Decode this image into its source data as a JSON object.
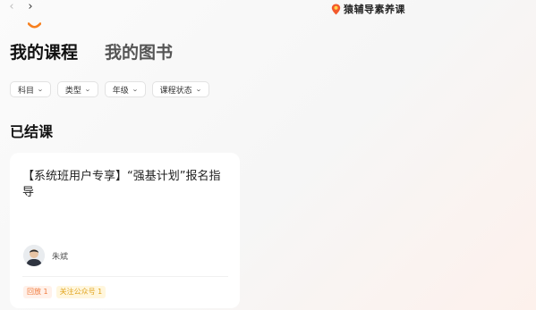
{
  "window": {
    "nav_back_icon": "chevron-left-icon",
    "nav_forward_icon": "chevron-right-icon",
    "brand_name": "猿辅导素养课",
    "brand_color": "#f25a2c"
  },
  "tabs": [
    {
      "label": "我的课程",
      "active": true
    },
    {
      "label": "我的图书",
      "active": false
    }
  ],
  "accent_color": "#f7801f",
  "filters": [
    {
      "label": "科目"
    },
    {
      "label": "类型"
    },
    {
      "label": "年级"
    },
    {
      "label": "课程状态"
    }
  ],
  "section": {
    "title": "已结课"
  },
  "courses": [
    {
      "title": "【系统班用户专享】“强基计划”报名指导",
      "teacher_name": "朱斌",
      "tags": [
        {
          "label": "回放 1",
          "color": "#f07a3c"
        },
        {
          "label": "关注公众号 1",
          "color": "#e0a31c"
        }
      ]
    }
  ]
}
